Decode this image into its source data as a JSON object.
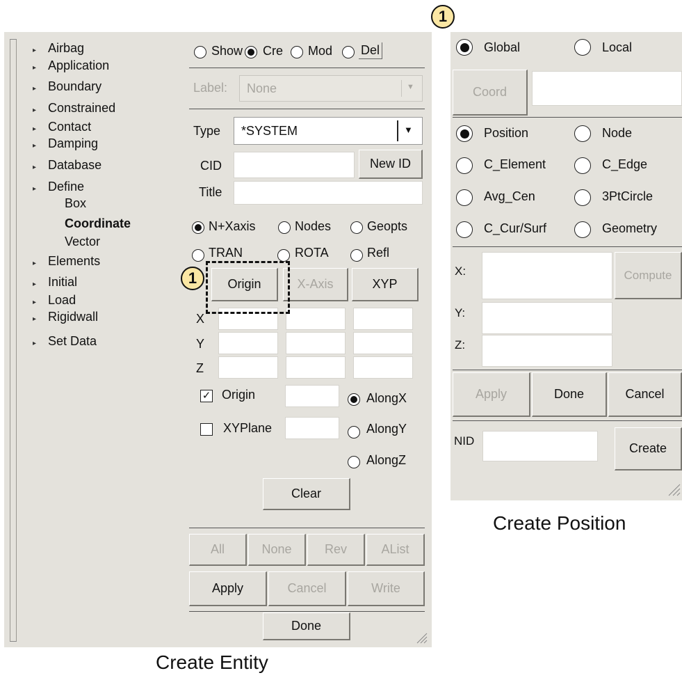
{
  "entity_panel": {
    "caption": "Create Entity",
    "tree": [
      {
        "label": "Airbag",
        "arrow": true
      },
      {
        "label": "Application",
        "arrow": true
      },
      {
        "label": "Boundary",
        "arrow": true
      },
      {
        "label": "Constrained",
        "arrow": true
      },
      {
        "label": "Contact",
        "arrow": true
      },
      {
        "label": "Damping",
        "arrow": true
      },
      {
        "label": "Database",
        "arrow": true
      },
      {
        "label": "Define",
        "arrow": true
      },
      {
        "label": "Box",
        "arrow": false
      },
      {
        "label": "Coordinate",
        "arrow": false,
        "selected": true
      },
      {
        "label": "Vector",
        "arrow": false
      },
      {
        "label": "Elements",
        "arrow": true
      },
      {
        "label": "Initial",
        "arrow": true
      },
      {
        "label": "Load",
        "arrow": true
      },
      {
        "label": "Rigidwall",
        "arrow": true
      },
      {
        "label": "Set Data",
        "arrow": true
      }
    ],
    "mode_radios": [
      {
        "label": "Show",
        "selected": false
      },
      {
        "label": "Cre",
        "selected": true
      },
      {
        "label": "Mod",
        "selected": false
      },
      {
        "label": "Del",
        "selected": false
      }
    ],
    "label_field": {
      "label": "Label:",
      "value": "None"
    },
    "type_field": {
      "label": "Type",
      "value": "*SYSTEM"
    },
    "cid": {
      "label": "CID",
      "value": "",
      "button": "New ID"
    },
    "title": {
      "label": "Title",
      "value": ""
    },
    "method_radios": [
      {
        "label": "N+Xaxis",
        "selected": true
      },
      {
        "label": "Nodes",
        "selected": false
      },
      {
        "label": "Geopts",
        "selected": false
      }
    ],
    "transform_radios": [
      {
        "label": "TRAN",
        "selected": false
      },
      {
        "label": "ROTA",
        "selected": false
      },
      {
        "label": "Refl",
        "selected": false
      }
    ],
    "point_buttons": {
      "origin": "Origin",
      "xaxis": "X-Axis",
      "xyp": "XYP"
    },
    "coord_rows": [
      "X",
      "Y",
      "Z"
    ],
    "origin_check": {
      "label": "Origin",
      "checked": true,
      "checkmark": "✓"
    },
    "xyplane_check": {
      "label": "XYPlane",
      "checked": false
    },
    "along_radios": [
      {
        "label": "AlongX",
        "selected": true
      },
      {
        "label": "AlongY",
        "selected": false
      },
      {
        "label": "AlongZ",
        "selected": false
      }
    ],
    "clear": "Clear",
    "select_buttons": {
      "all": "All",
      "none": "None",
      "rev": "Rev",
      "alist": "AList"
    },
    "action_buttons": {
      "apply": "Apply",
      "cancel": "Cancel",
      "write": "Write"
    },
    "done": "Done",
    "badge": "1"
  },
  "position_panel": {
    "caption": "Create Position",
    "badge": "1",
    "frame_radios": [
      {
        "label": "Global",
        "selected": true
      },
      {
        "label": "Local",
        "selected": false
      }
    ],
    "coord_button": "Coord",
    "position_radios": [
      {
        "label": "Position",
        "selected": true
      },
      {
        "label": "Node",
        "selected": false
      },
      {
        "label": "C_Element",
        "selected": false
      },
      {
        "label": "C_Edge",
        "selected": false
      },
      {
        "label": "Avg_Cen",
        "selected": false
      },
      {
        "label": "3PtCircle",
        "selected": false
      },
      {
        "label": "C_Cur/Surf",
        "selected": false
      },
      {
        "label": "Geometry",
        "selected": false
      }
    ],
    "xyz_labels": {
      "x": "X:",
      "y": "Y:",
      "z": "Z:"
    },
    "compute": "Compute",
    "buttons": {
      "apply": "Apply",
      "done": "Done",
      "cancel": "Cancel"
    },
    "nid": {
      "label": "NID",
      "value": "",
      "button": "Create"
    }
  }
}
